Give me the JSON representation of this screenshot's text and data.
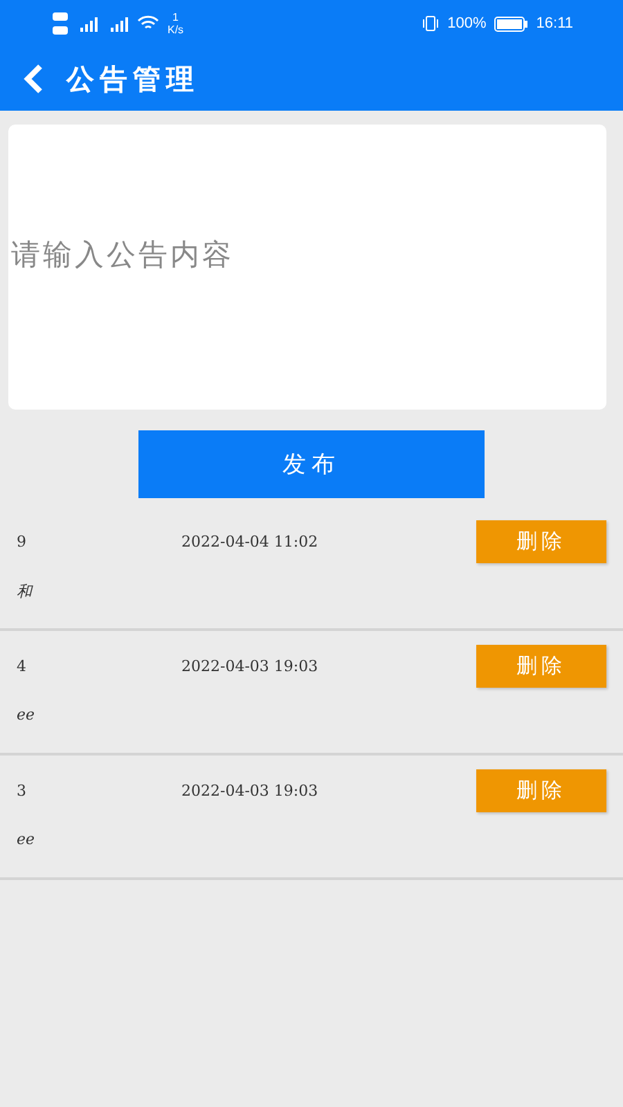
{
  "status_bar": {
    "network_speed": "1",
    "speed_unit": "K/s",
    "battery": "100%",
    "time": "16:11"
  },
  "header": {
    "title": "公告管理"
  },
  "editor": {
    "placeholder": "请输入公告内容"
  },
  "publish_button": "发布",
  "notices": [
    {
      "id": "9",
      "time": "2022-04-04 11:02",
      "content": "和",
      "delete": "删除"
    },
    {
      "id": "4",
      "time": "2022-04-03 19:03",
      "content": "ee",
      "delete": "删除"
    },
    {
      "id": "3",
      "time": "2022-04-03 19:03",
      "content": "ee",
      "delete": "删除"
    }
  ]
}
